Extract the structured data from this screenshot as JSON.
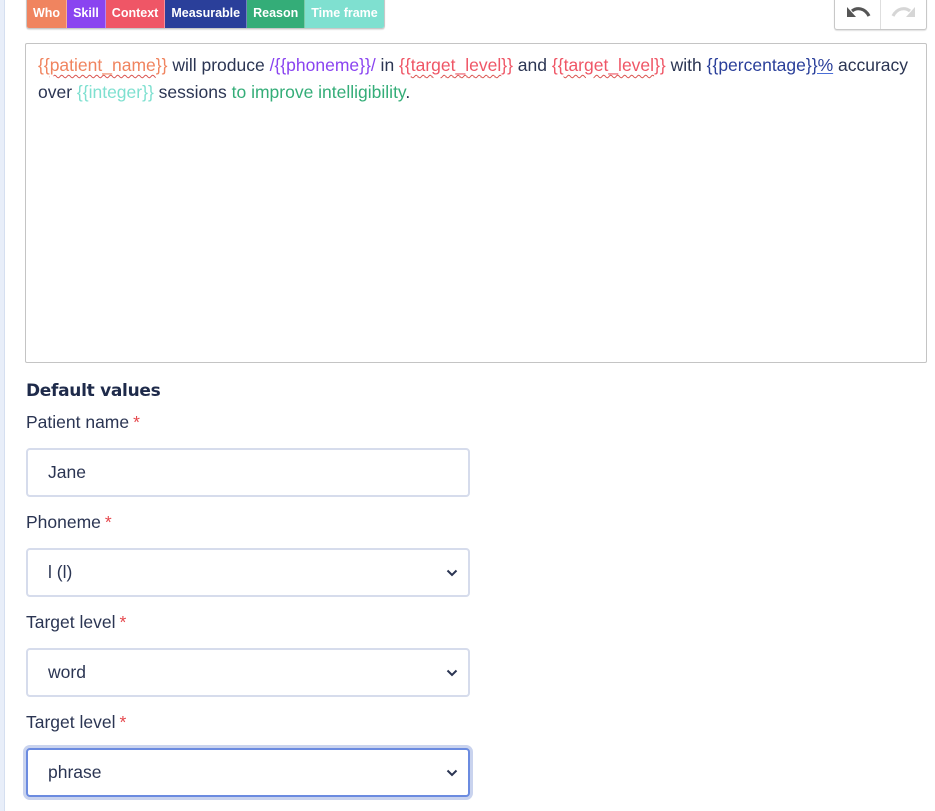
{
  "tags": [
    {
      "label": "Who",
      "color": "#f0845f"
    },
    {
      "label": "Skill",
      "color": "#8a44f0"
    },
    {
      "label": "Context",
      "color": "#ef5666"
    },
    {
      "label": "Measurable",
      "color": "#2a3f9a"
    },
    {
      "label": "Reason",
      "color": "#34ad78"
    },
    {
      "label": "Time frame",
      "color": "#7fe0d0"
    }
  ],
  "toolbar": {
    "undo_icon": "undo-icon",
    "redo_icon": "redo-icon"
  },
  "editor": {
    "segments": [
      {
        "text": "{{patient_name}}",
        "color": "#f0845f",
        "style": "squiggle",
        "prefix": "{{",
        "body": "patient_name",
        "suffix": "}}"
      },
      {
        "text": " will produce ",
        "color": "#2b3553"
      },
      {
        "text": "/{{phoneme}}/",
        "color": "#8a44f0"
      },
      {
        "text": " in ",
        "color": "#2b3553"
      },
      {
        "text": "{{target_level}}",
        "color": "#ef5666",
        "style": "squiggle"
      },
      {
        "text": " and ",
        "color": "#2b3553"
      },
      {
        "text": "{{target_level}}",
        "color": "#ef5666",
        "style": "squiggle"
      },
      {
        "text": " with ",
        "color": "#2b3553"
      },
      {
        "text": "{{percentage}}%",
        "color": "#2a3f9a",
        "style": "partial-underline"
      },
      {
        "text": " accuracy over ",
        "color": "#2b3553"
      },
      {
        "text": "{{integer}}",
        "color": "#7fe0d0"
      },
      {
        "text": " sessions ",
        "color": "#2b3553"
      },
      {
        "text": "to improve intelligibility",
        "color": "#34ad78"
      },
      {
        "text": ".",
        "color": "#2b3553"
      }
    ]
  },
  "defaults": {
    "title": "Default values",
    "required_mark": "*",
    "fields": [
      {
        "label": "Patient name",
        "type": "text",
        "value": "Jane"
      },
      {
        "label": "Phoneme",
        "type": "select",
        "value": "l (l)"
      },
      {
        "label": "Target level",
        "type": "select",
        "value": "word"
      },
      {
        "label": "Target level",
        "type": "select",
        "value": "phrase",
        "focused": true
      }
    ]
  }
}
